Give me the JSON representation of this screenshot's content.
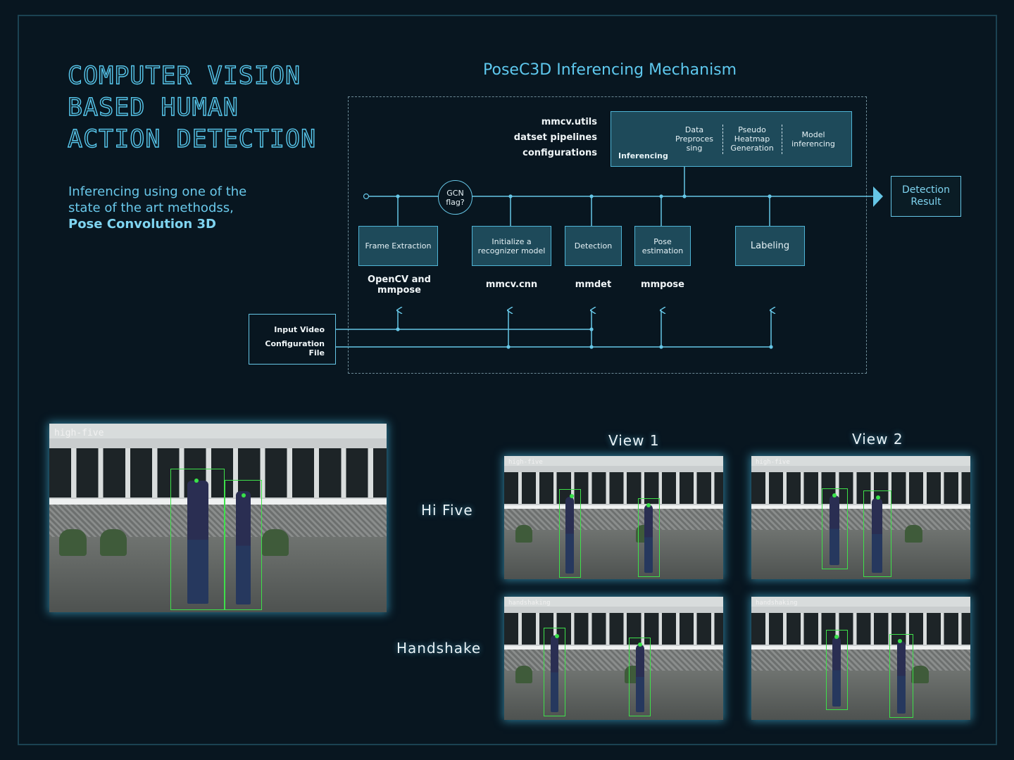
{
  "hero": {
    "title_lines": [
      "COMPUTER VISION",
      "BASED HUMAN",
      "ACTION DETECTION"
    ],
    "subtitle_lines": [
      "Inferencing using one of the",
      "state of the art methodss,"
    ],
    "subtitle_strong": "Pose Convolution 3D"
  },
  "diagram": {
    "title": "PoseC3D Inferencing Mechanism",
    "libs_top": [
      "mmcv.utils",
      "datset pipelines",
      "configurations"
    ],
    "inferencing": {
      "label": "Inferencing",
      "steps": [
        [
          "Data",
          "Preproces",
          "sing"
        ],
        [
          "Pseudo",
          "Heatmap",
          "Generation"
        ],
        [
          "Model",
          "inferencing"
        ]
      ]
    },
    "gcn_flag": [
      "GCN",
      "flag?"
    ],
    "stages": [
      {
        "label": [
          "Frame Extraction"
        ],
        "lib": [
          "OpenCV and",
          "mmpose"
        ]
      },
      {
        "label": [
          "Initialize a",
          "recognizer model"
        ],
        "lib": [
          "mmcv.cnn"
        ]
      },
      {
        "label": [
          "Detection"
        ],
        "lib": [
          "mmdet"
        ]
      },
      {
        "label": [
          "Pose",
          "estimation"
        ],
        "lib": [
          "mmpose"
        ]
      },
      {
        "label": [
          "Labeling"
        ],
        "lib": []
      }
    ],
    "result": [
      "Detection",
      "Result"
    ],
    "input": [
      "Input Video",
      "Configuration",
      "File"
    ]
  },
  "gallery": {
    "main_tag": "high-five",
    "captions": {
      "view1": "View 1",
      "view2": "View 2",
      "row1": "Hi Five",
      "row2": "Handshake"
    },
    "tags": {
      "v1_r1": "high-five",
      "v2_r1": "high-five",
      "v1_r2": "handshaking",
      "v2_r2": "handshaking"
    }
  },
  "colors": {
    "background": "#081620",
    "accent": "#5ec8ee",
    "box_fill": "#1e4a5a",
    "skeleton": "#39e24a"
  }
}
